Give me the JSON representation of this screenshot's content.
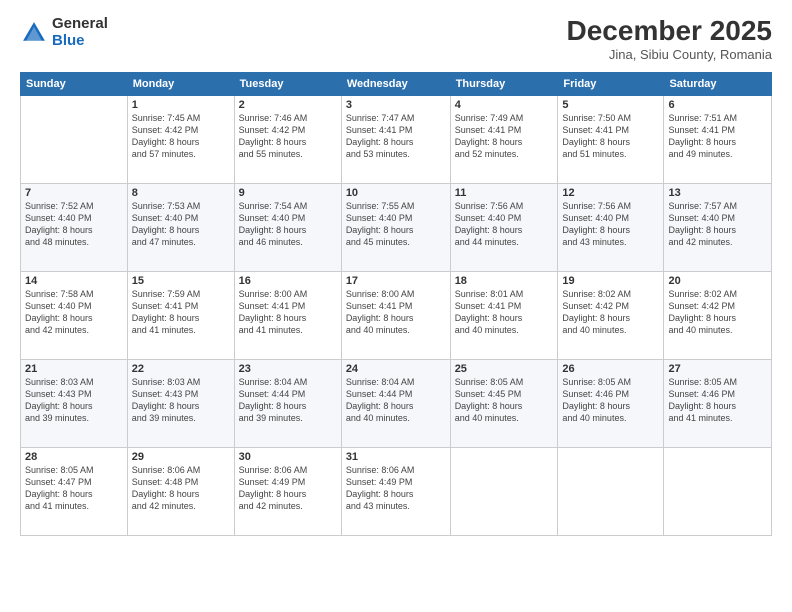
{
  "logo": {
    "general": "General",
    "blue": "Blue"
  },
  "header": {
    "month": "December 2025",
    "location": "Jina, Sibiu County, Romania"
  },
  "weekdays": [
    "Sunday",
    "Monday",
    "Tuesday",
    "Wednesday",
    "Thursday",
    "Friday",
    "Saturday"
  ],
  "weeks": [
    [
      {
        "day": "",
        "info": ""
      },
      {
        "day": "1",
        "info": "Sunrise: 7:45 AM\nSunset: 4:42 PM\nDaylight: 8 hours\nand 57 minutes."
      },
      {
        "day": "2",
        "info": "Sunrise: 7:46 AM\nSunset: 4:42 PM\nDaylight: 8 hours\nand 55 minutes."
      },
      {
        "day": "3",
        "info": "Sunrise: 7:47 AM\nSunset: 4:41 PM\nDaylight: 8 hours\nand 53 minutes."
      },
      {
        "day": "4",
        "info": "Sunrise: 7:49 AM\nSunset: 4:41 PM\nDaylight: 8 hours\nand 52 minutes."
      },
      {
        "day": "5",
        "info": "Sunrise: 7:50 AM\nSunset: 4:41 PM\nDaylight: 8 hours\nand 51 minutes."
      },
      {
        "day": "6",
        "info": "Sunrise: 7:51 AM\nSunset: 4:41 PM\nDaylight: 8 hours\nand 49 minutes."
      }
    ],
    [
      {
        "day": "7",
        "info": "Sunrise: 7:52 AM\nSunset: 4:40 PM\nDaylight: 8 hours\nand 48 minutes."
      },
      {
        "day": "8",
        "info": "Sunrise: 7:53 AM\nSunset: 4:40 PM\nDaylight: 8 hours\nand 47 minutes."
      },
      {
        "day": "9",
        "info": "Sunrise: 7:54 AM\nSunset: 4:40 PM\nDaylight: 8 hours\nand 46 minutes."
      },
      {
        "day": "10",
        "info": "Sunrise: 7:55 AM\nSunset: 4:40 PM\nDaylight: 8 hours\nand 45 minutes."
      },
      {
        "day": "11",
        "info": "Sunrise: 7:56 AM\nSunset: 4:40 PM\nDaylight: 8 hours\nand 44 minutes."
      },
      {
        "day": "12",
        "info": "Sunrise: 7:56 AM\nSunset: 4:40 PM\nDaylight: 8 hours\nand 43 minutes."
      },
      {
        "day": "13",
        "info": "Sunrise: 7:57 AM\nSunset: 4:40 PM\nDaylight: 8 hours\nand 42 minutes."
      }
    ],
    [
      {
        "day": "14",
        "info": "Sunrise: 7:58 AM\nSunset: 4:40 PM\nDaylight: 8 hours\nand 42 minutes."
      },
      {
        "day": "15",
        "info": "Sunrise: 7:59 AM\nSunset: 4:41 PM\nDaylight: 8 hours\nand 41 minutes."
      },
      {
        "day": "16",
        "info": "Sunrise: 8:00 AM\nSunset: 4:41 PM\nDaylight: 8 hours\nand 41 minutes."
      },
      {
        "day": "17",
        "info": "Sunrise: 8:00 AM\nSunset: 4:41 PM\nDaylight: 8 hours\nand 40 minutes."
      },
      {
        "day": "18",
        "info": "Sunrise: 8:01 AM\nSunset: 4:41 PM\nDaylight: 8 hours\nand 40 minutes."
      },
      {
        "day": "19",
        "info": "Sunrise: 8:02 AM\nSunset: 4:42 PM\nDaylight: 8 hours\nand 40 minutes."
      },
      {
        "day": "20",
        "info": "Sunrise: 8:02 AM\nSunset: 4:42 PM\nDaylight: 8 hours\nand 40 minutes."
      }
    ],
    [
      {
        "day": "21",
        "info": "Sunrise: 8:03 AM\nSunset: 4:43 PM\nDaylight: 8 hours\nand 39 minutes."
      },
      {
        "day": "22",
        "info": "Sunrise: 8:03 AM\nSunset: 4:43 PM\nDaylight: 8 hours\nand 39 minutes."
      },
      {
        "day": "23",
        "info": "Sunrise: 8:04 AM\nSunset: 4:44 PM\nDaylight: 8 hours\nand 39 minutes."
      },
      {
        "day": "24",
        "info": "Sunrise: 8:04 AM\nSunset: 4:44 PM\nDaylight: 8 hours\nand 40 minutes."
      },
      {
        "day": "25",
        "info": "Sunrise: 8:05 AM\nSunset: 4:45 PM\nDaylight: 8 hours\nand 40 minutes."
      },
      {
        "day": "26",
        "info": "Sunrise: 8:05 AM\nSunset: 4:46 PM\nDaylight: 8 hours\nand 40 minutes."
      },
      {
        "day": "27",
        "info": "Sunrise: 8:05 AM\nSunset: 4:46 PM\nDaylight: 8 hours\nand 41 minutes."
      }
    ],
    [
      {
        "day": "28",
        "info": "Sunrise: 8:05 AM\nSunset: 4:47 PM\nDaylight: 8 hours\nand 41 minutes."
      },
      {
        "day": "29",
        "info": "Sunrise: 8:06 AM\nSunset: 4:48 PM\nDaylight: 8 hours\nand 42 minutes."
      },
      {
        "day": "30",
        "info": "Sunrise: 8:06 AM\nSunset: 4:49 PM\nDaylight: 8 hours\nand 42 minutes."
      },
      {
        "day": "31",
        "info": "Sunrise: 8:06 AM\nSunset: 4:49 PM\nDaylight: 8 hours\nand 43 minutes."
      },
      {
        "day": "",
        "info": ""
      },
      {
        "day": "",
        "info": ""
      },
      {
        "day": "",
        "info": ""
      }
    ]
  ]
}
